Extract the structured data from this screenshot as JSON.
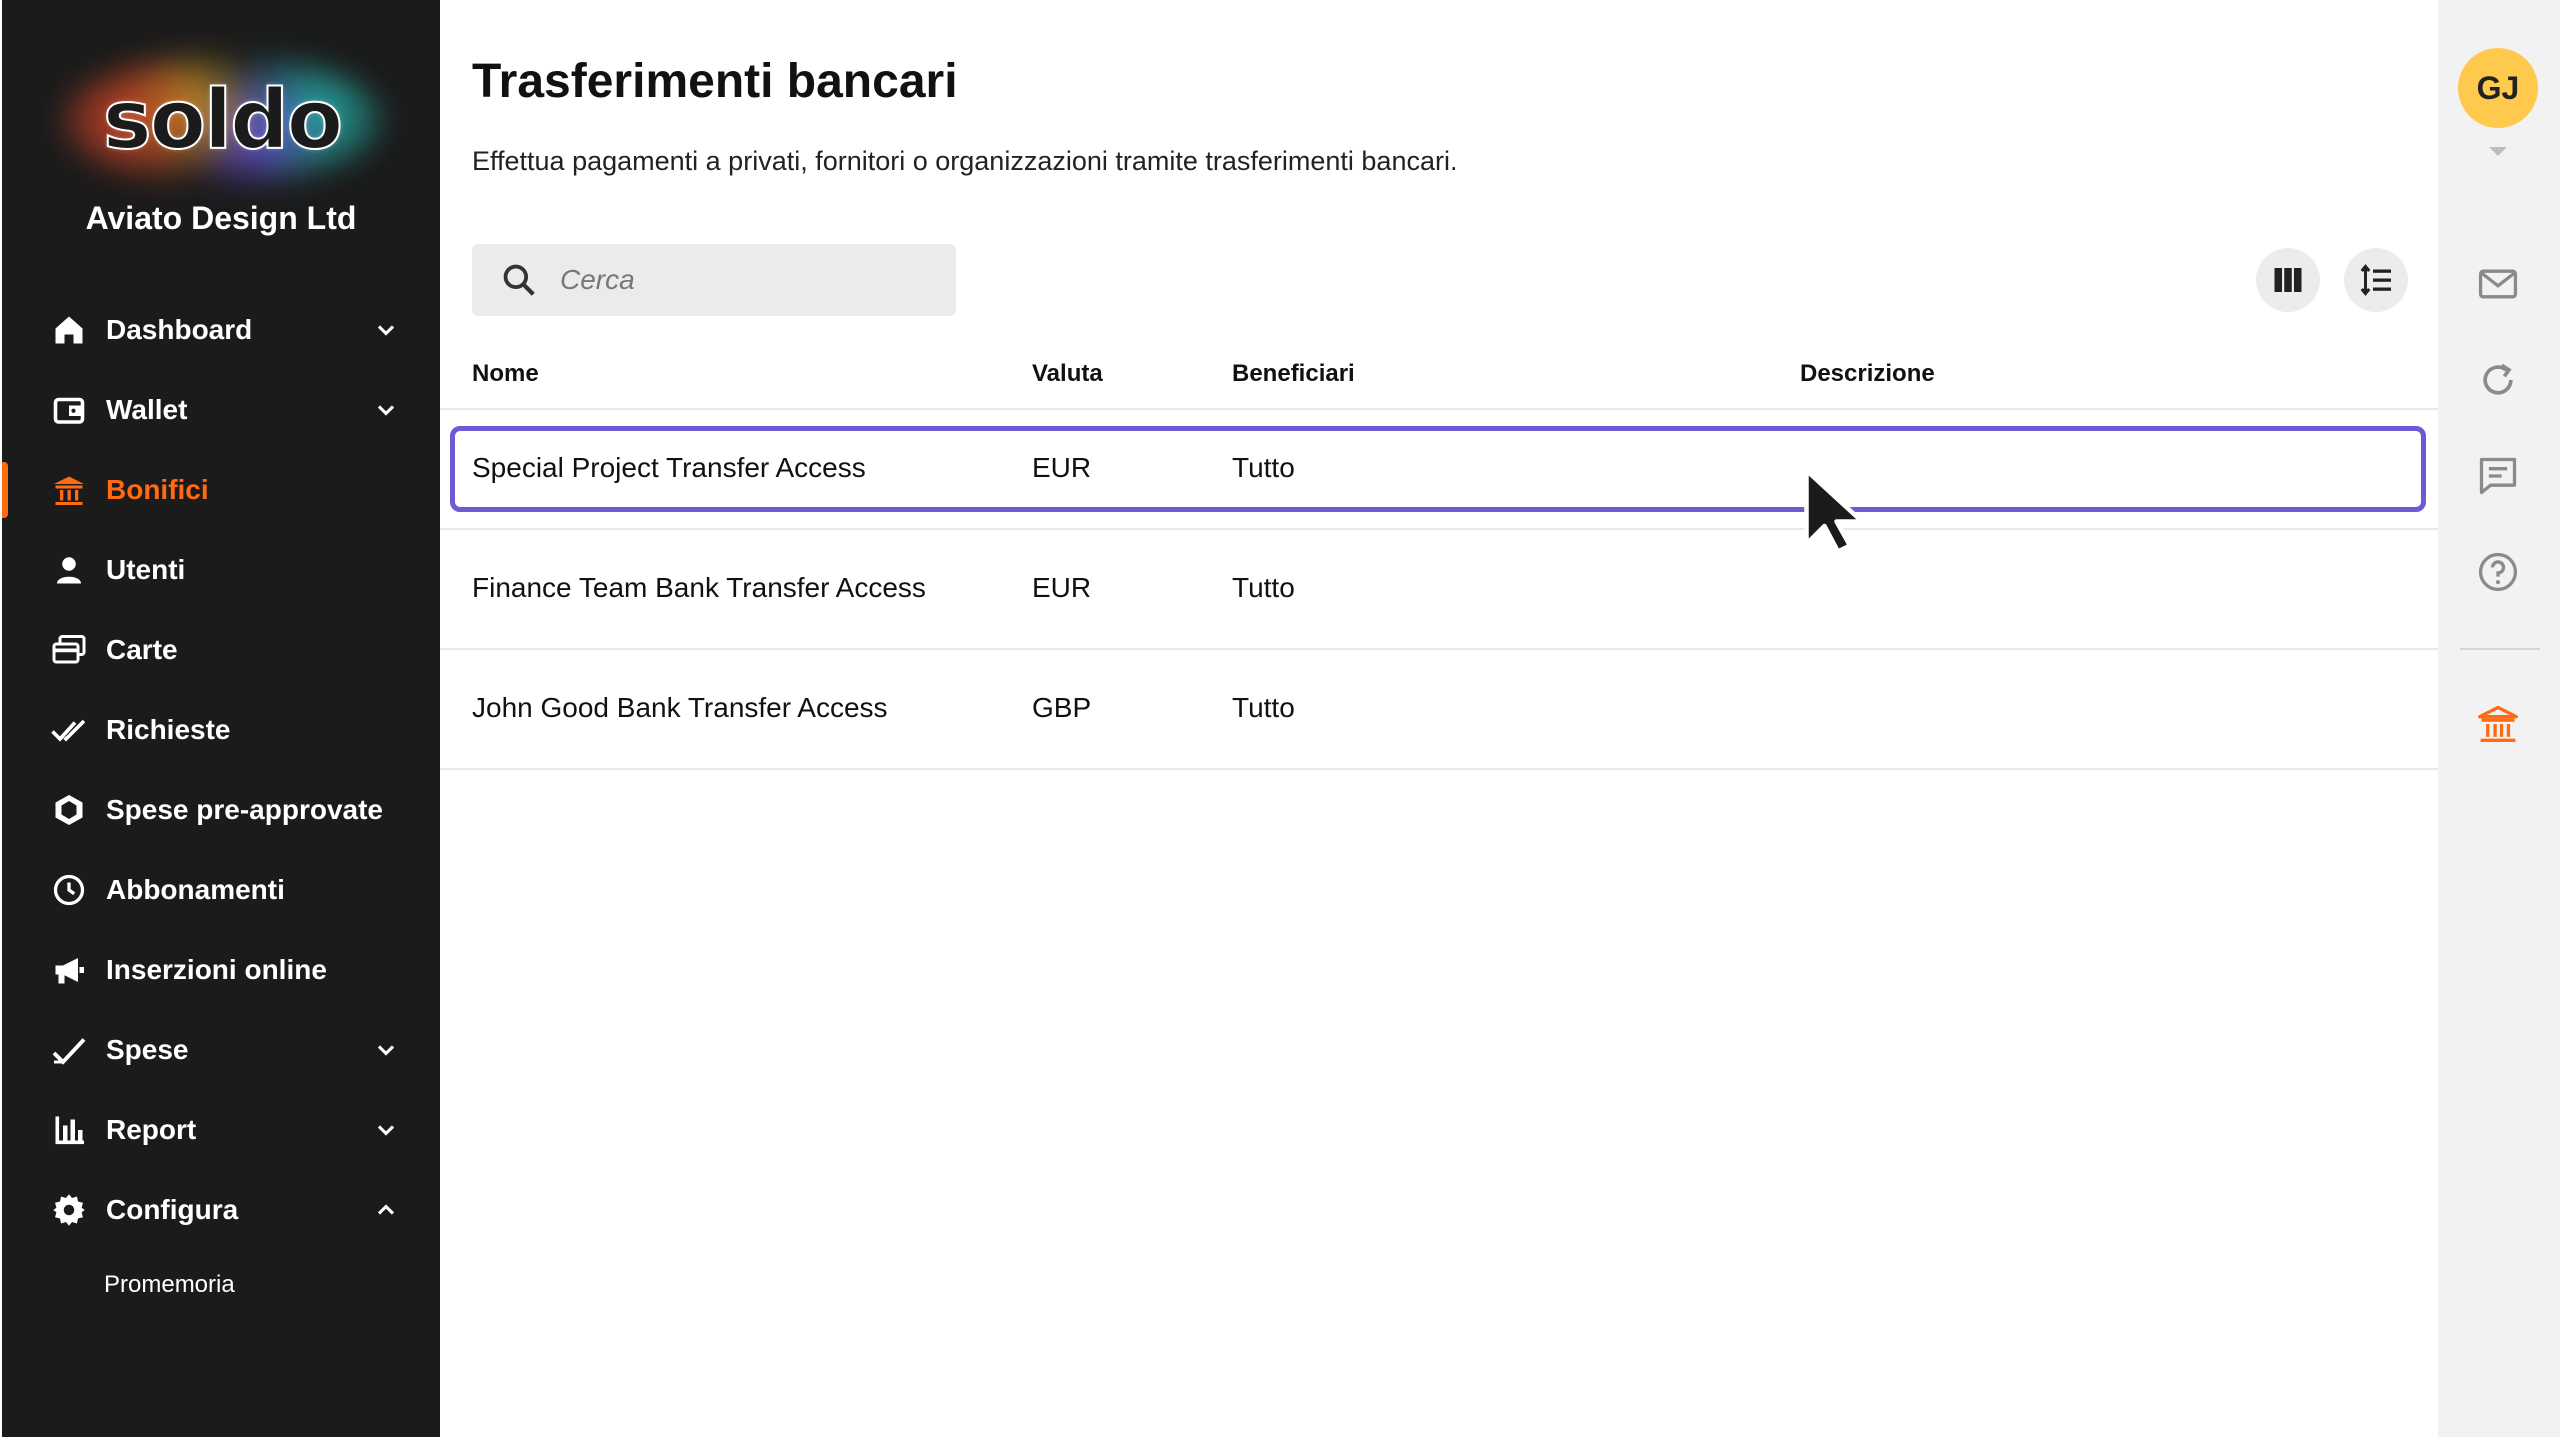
{
  "brand": {
    "logo_text": "soldo",
    "company_name": "Aviato Design Ltd",
    "accent_color": "#ff6a13"
  },
  "nav": {
    "items": [
      {
        "label": "Dashboard",
        "icon": "home-icon",
        "has_chevron": true
      },
      {
        "label": "Wallet",
        "icon": "wallet-icon",
        "has_chevron": true
      },
      {
        "label": "Bonifici",
        "icon": "bank-icon",
        "active": true
      },
      {
        "label": "Utenti",
        "icon": "user-icon"
      },
      {
        "label": "Carte",
        "icon": "cards-icon"
      },
      {
        "label": "Richieste",
        "icon": "double-check-icon"
      },
      {
        "label": "Spese pre-approvate",
        "icon": "hexagon-check-icon"
      },
      {
        "label": "Abbonamenti",
        "icon": "clock-icon"
      },
      {
        "label": "Inserzioni online",
        "icon": "megaphone-icon"
      },
      {
        "label": "Spese",
        "icon": "check-icon",
        "has_chevron": true
      },
      {
        "label": "Report",
        "icon": "bar-chart-icon",
        "has_chevron": true
      },
      {
        "label": "Configura",
        "icon": "gear-icon",
        "has_chevron": true,
        "expanded": true
      }
    ],
    "sub_items": [
      {
        "label": "Promemoria"
      }
    ]
  },
  "page": {
    "title": "Trasferimenti bancari",
    "subtitle": "Effettua pagamenti a privati, fornitori o organizzazioni tramite trasferimenti bancari."
  },
  "search": {
    "placeholder": "Cerca",
    "value": ""
  },
  "toolbar": {
    "columns_icon": "columns-icon",
    "density_icon": "row-height-icon"
  },
  "table": {
    "columns": [
      "Nome",
      "Valuta",
      "Beneficiari",
      "Descrizione"
    ],
    "rows": [
      {
        "nome": "Special Project Transfer Access",
        "valuta": "EUR",
        "beneficiari": "Tutto",
        "descrizione": "",
        "selected": true
      },
      {
        "nome": "Finance Team Bank Transfer Access",
        "valuta": "EUR",
        "beneficiari": "Tutto",
        "descrizione": ""
      },
      {
        "nome": "John Good Bank Transfer Access",
        "valuta": "GBP",
        "beneficiari": "Tutto",
        "descrizione": ""
      }
    ]
  },
  "rail": {
    "avatar_initials": "GJ",
    "avatar_color": "#ffc94d",
    "icons": [
      "mail-icon",
      "refresh-icon",
      "chat-icon",
      "help-icon",
      "bank-icon"
    ],
    "selection_color": "#6c5bd4"
  }
}
